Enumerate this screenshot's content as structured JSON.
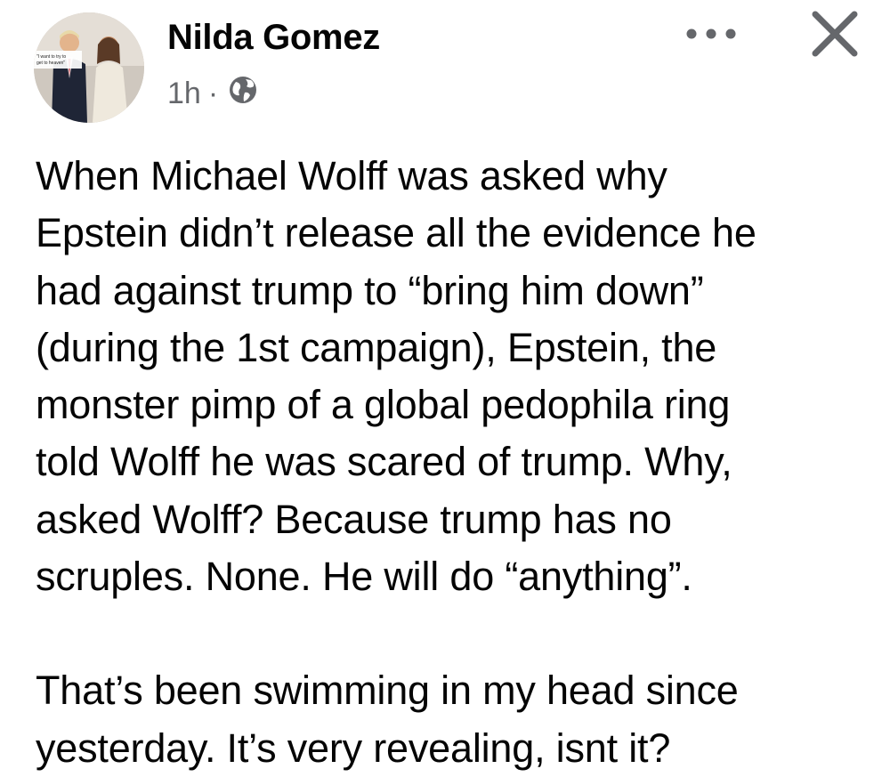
{
  "post": {
    "author_name": "Nilda Gomez",
    "avatar_caption": [
      "\"I want to try to",
      "get to heaven\""
    ],
    "timestamp": "1h",
    "separator": "·",
    "audience_icon": "globe-icon",
    "more_icon": "more-options-icon",
    "close_icon": "close-icon",
    "paragraphs": [
      [
        "When Michael Wolff was asked why",
        "Epstein didn’t release all the evidence he",
        "had against trump to “bring him down”",
        "(during the 1st campaign), Epstein, the",
        "monster pimp of a global pedophila ring",
        "told Wolff he was scared of trump. Why,",
        "asked Wolff? Because trump has no",
        "scruples. None. He will do “anything”."
      ],
      [
        "That’s been swimming in my head since",
        "yesterday. It’s very revealing, isnt it?"
      ]
    ]
  },
  "colors": {
    "text": "#050505",
    "secondary_text": "#65676b",
    "background": "#ffffff"
  }
}
